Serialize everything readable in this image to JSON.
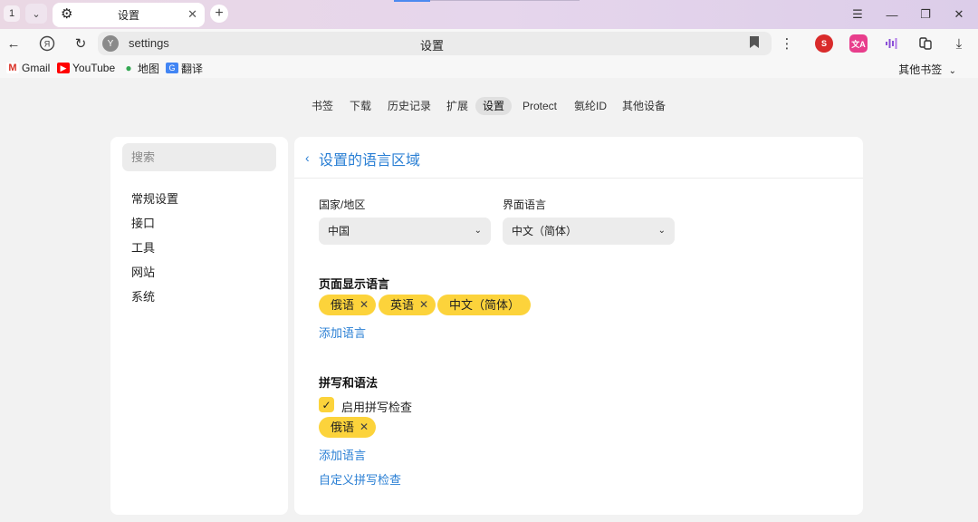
{
  "window": {
    "tab_count": "1",
    "tab_title": "设置",
    "minimize_glyph": "—",
    "restore_glyph": "❐",
    "close_glyph": "✕",
    "menu_glyph": "☰"
  },
  "toolbar": {
    "url": "settings",
    "page_title": "设置",
    "extensions": [
      {
        "name": "seo-extension-icon",
        "color": "#d92b2b",
        "label": "S"
      },
      {
        "name": "translate-extension-icon",
        "color": "#e83e8c",
        "label": "文A"
      },
      {
        "name": "audio-extension-icon",
        "color": "#8a4fd6",
        "label": ""
      },
      {
        "name": "reader-extension-icon",
        "color": "#333333",
        "label": ""
      }
    ]
  },
  "bookmarks": {
    "items": [
      {
        "label": "Gmail",
        "icon": "gmail-icon",
        "color": "#d93025"
      },
      {
        "label": "YouTube",
        "icon": "youtube-icon",
        "color": "#ff0000"
      },
      {
        "label": "地图",
        "icon": "maps-icon",
        "color": "#34a853"
      },
      {
        "label": "翻译",
        "icon": "translate-icon",
        "color": "#4285f4"
      }
    ],
    "other": "其他书签"
  },
  "settings_nav": {
    "items": [
      "书签",
      "下载",
      "历史记录",
      "扩展",
      "设置",
      "Protect",
      "氨纶ID",
      "其他设备"
    ],
    "active_index": 4
  },
  "sidebar": {
    "search_placeholder": "搜索",
    "items": [
      "常规设置",
      "接口",
      "工具",
      "网站",
      "系统"
    ]
  },
  "main": {
    "title": "设置的语言区域",
    "country_label": "国家/地区",
    "country_value": "中国",
    "ui_language_label": "界面语言",
    "ui_language_value": "中文（简体）",
    "display_section": "页面显示语言",
    "display_languages": [
      {
        "label": "俄语",
        "removable": true
      },
      {
        "label": "英语",
        "removable": true
      },
      {
        "label": "中文（简体）",
        "removable": false
      }
    ],
    "add_language": "添加语言",
    "spell_section": "拼写和语法",
    "spell_check_label": "启用拼写检查",
    "spell_check_enabled": true,
    "spell_languages": [
      {
        "label": "俄语",
        "removable": true
      }
    ],
    "add_language_2": "添加语言",
    "custom_spell": "自定义拼写检查"
  },
  "colors": {
    "accent": "#2a7fd4",
    "chip": "#fcd33b"
  }
}
